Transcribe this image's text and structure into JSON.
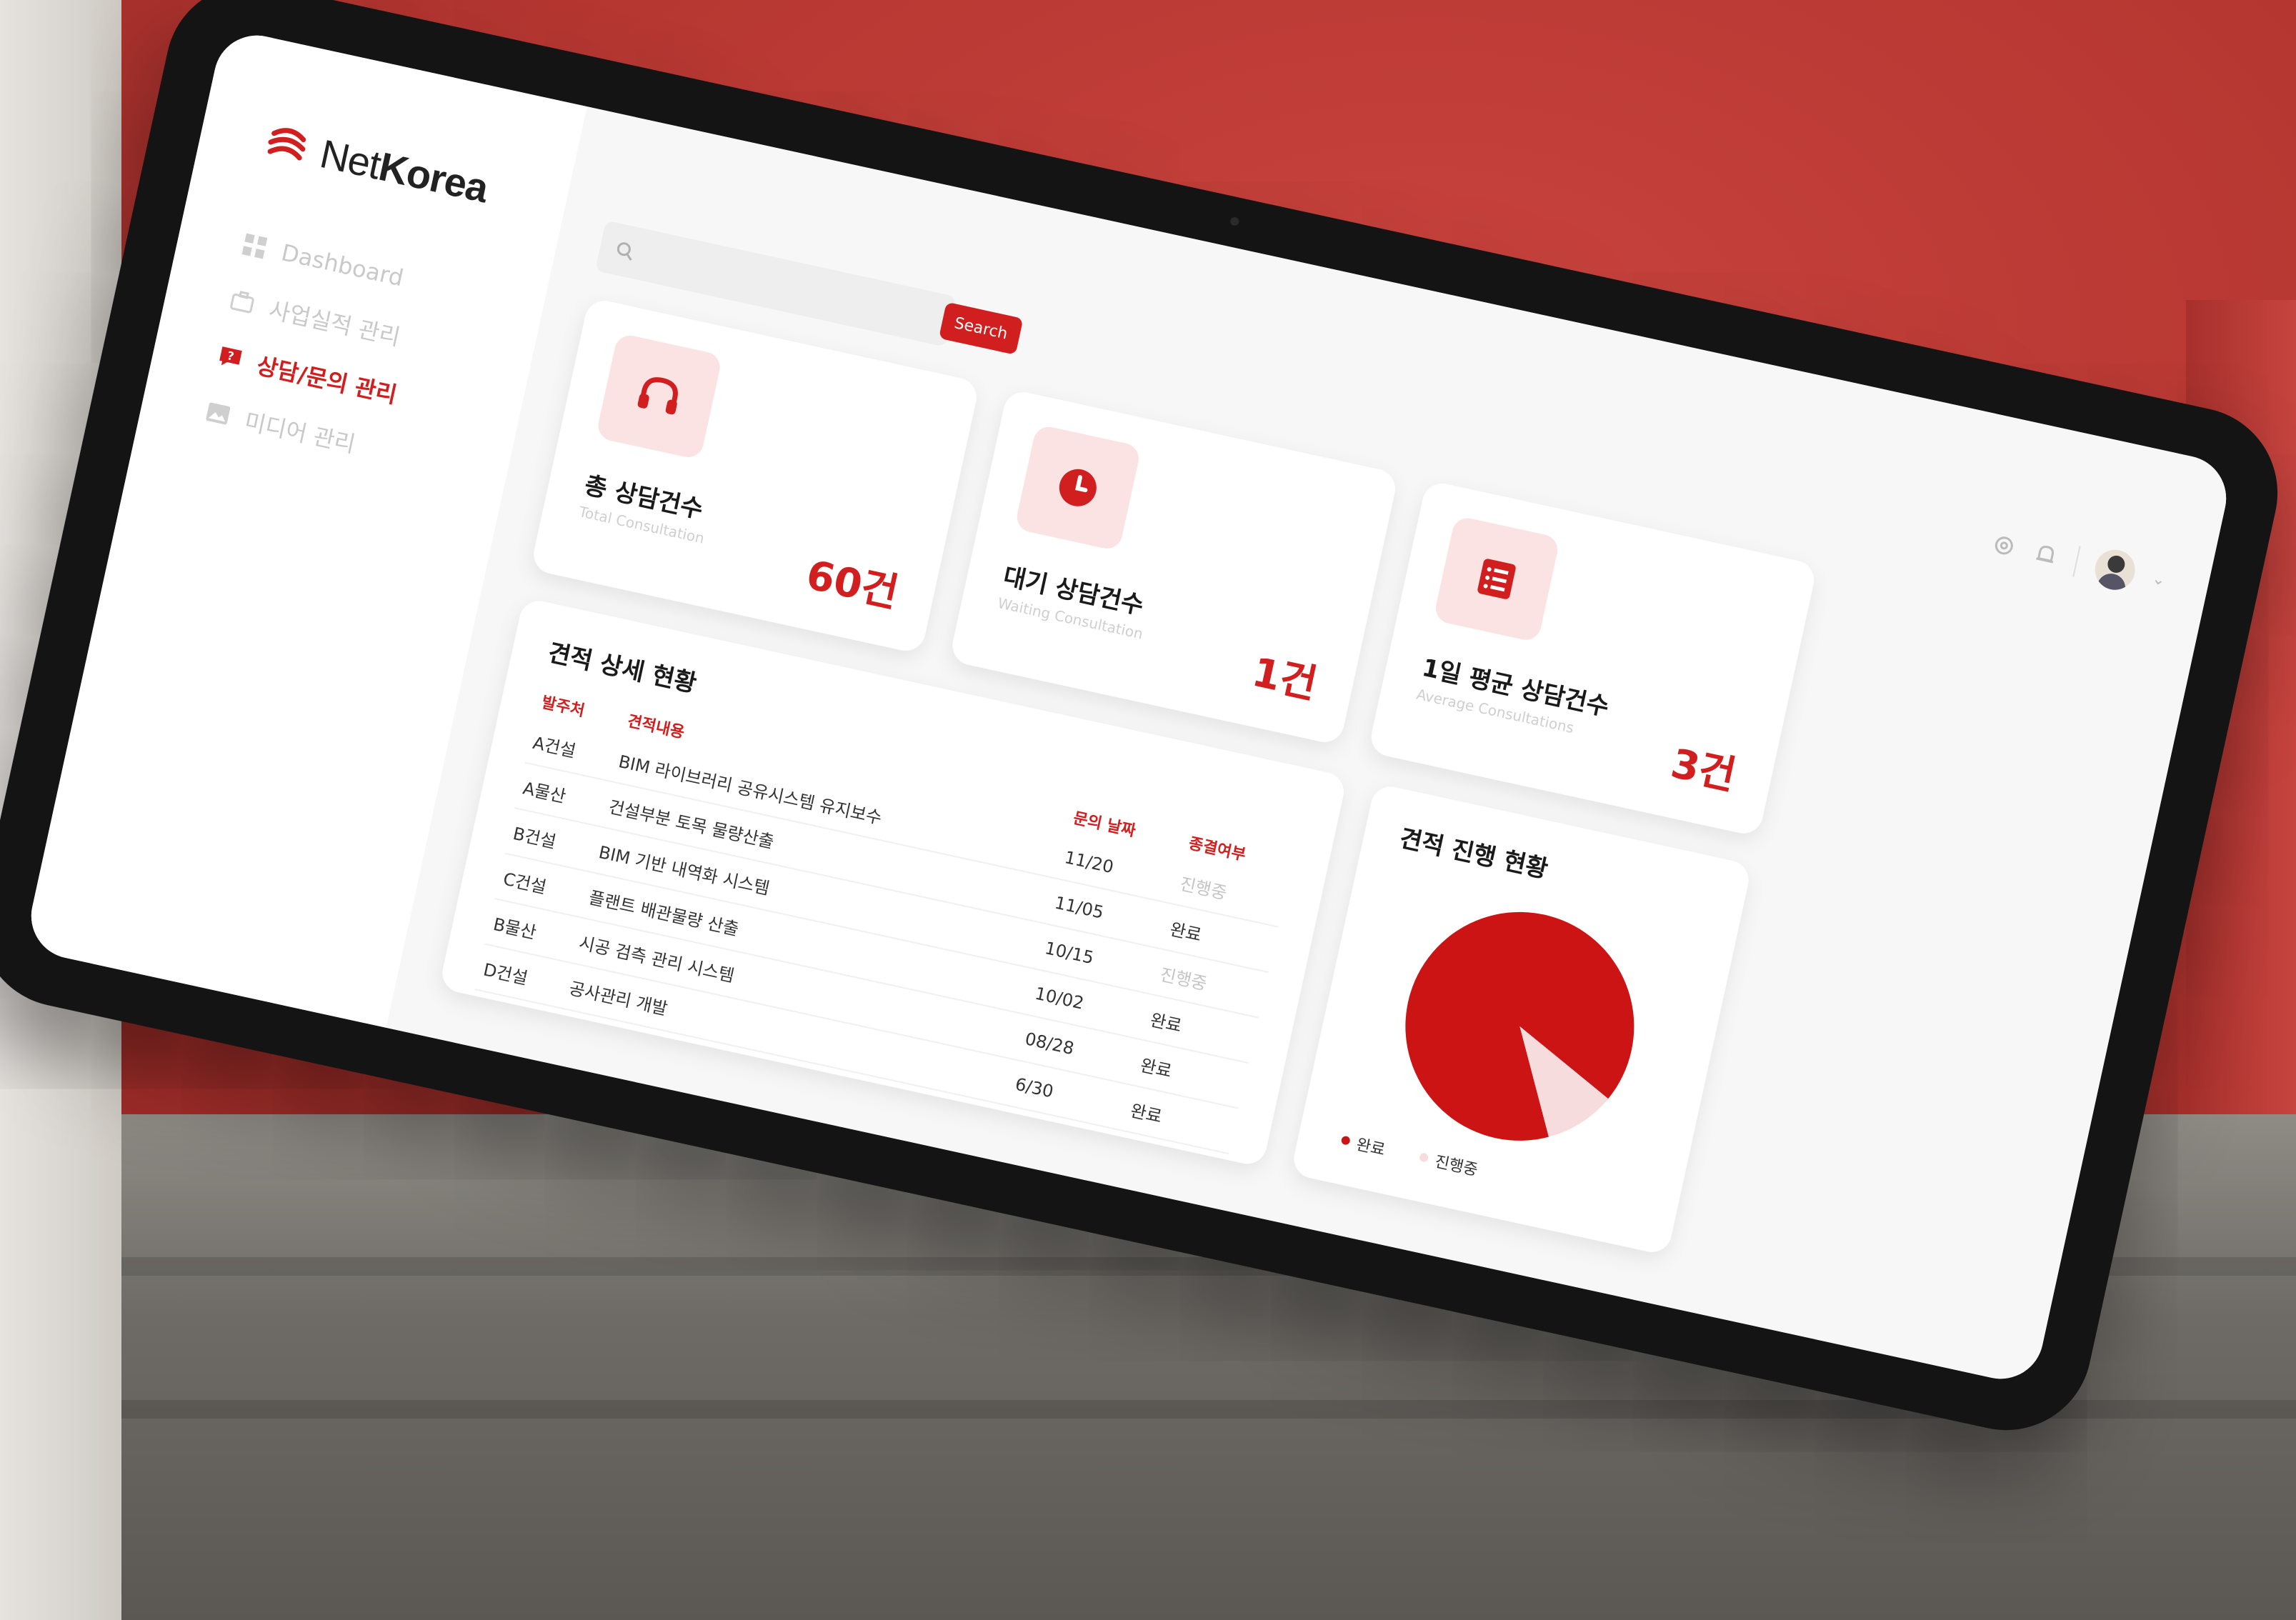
{
  "brand": {
    "name_prefix": "Net",
    "name_suffix": "Korea"
  },
  "sidebar": {
    "items": [
      {
        "label": "Dashboard",
        "icon": "grid-icon",
        "active": false
      },
      {
        "label": "사업실적 관리",
        "icon": "briefcase-icon",
        "active": false
      },
      {
        "label": "상담/문의 관리",
        "icon": "question-chat-icon",
        "active": true
      },
      {
        "label": "미디어 관리",
        "icon": "image-icon",
        "active": false
      }
    ]
  },
  "search": {
    "placeholder": "",
    "button_label": "Search"
  },
  "header": {
    "icons": [
      "gear-icon",
      "bell-icon"
    ],
    "avatar": "user-avatar"
  },
  "stats": [
    {
      "title": "총 상담건수",
      "subtitle": "Total Consultation",
      "value": "60건",
      "icon": "headset-icon"
    },
    {
      "title": "대기 상담건수",
      "subtitle": "Waiting Consultation",
      "value": "1건",
      "icon": "clock-icon"
    },
    {
      "title": "1일 평균 상담건수",
      "subtitle": "Average Consultations",
      "value": "3건",
      "icon": "list-icon"
    }
  ],
  "detail_table": {
    "title": "견적 상세 현황",
    "columns": [
      "발주처",
      "견적내용",
      "문의 날짜",
      "종결여부"
    ],
    "rows": [
      [
        "A건설",
        "BIM 라이브러리 공유시스템 유지보수",
        "11/20",
        "진행중"
      ],
      [
        "A물산",
        "건설부분 토목 물량산출",
        "11/05",
        "완료"
      ],
      [
        "B건설",
        "BIM 기반 내역화 시스템",
        "10/15",
        "진행중"
      ],
      [
        "C건설",
        "플랜트 배관물량 산출",
        "10/02",
        "완료"
      ],
      [
        "B물산",
        "시공 검측 관리 시스템",
        "08/28",
        "완료"
      ],
      [
        "D건설",
        "공사관리 개발",
        "6/30",
        "완료"
      ]
    ]
  },
  "progress_chart": {
    "title": "견적 진행 현황",
    "legend": [
      "완료",
      "진행중"
    ],
    "colors": {
      "primary": "#cc1414",
      "light": "#f6dcdc"
    }
  },
  "chart_data": {
    "type": "pie",
    "categories": [
      "완료",
      "진행중"
    ],
    "values": [
      90,
      10
    ],
    "title": "견적 진행 현황"
  },
  "colors": {
    "accent": "#d11f1f",
    "accent_light": "#fbe3e3"
  }
}
